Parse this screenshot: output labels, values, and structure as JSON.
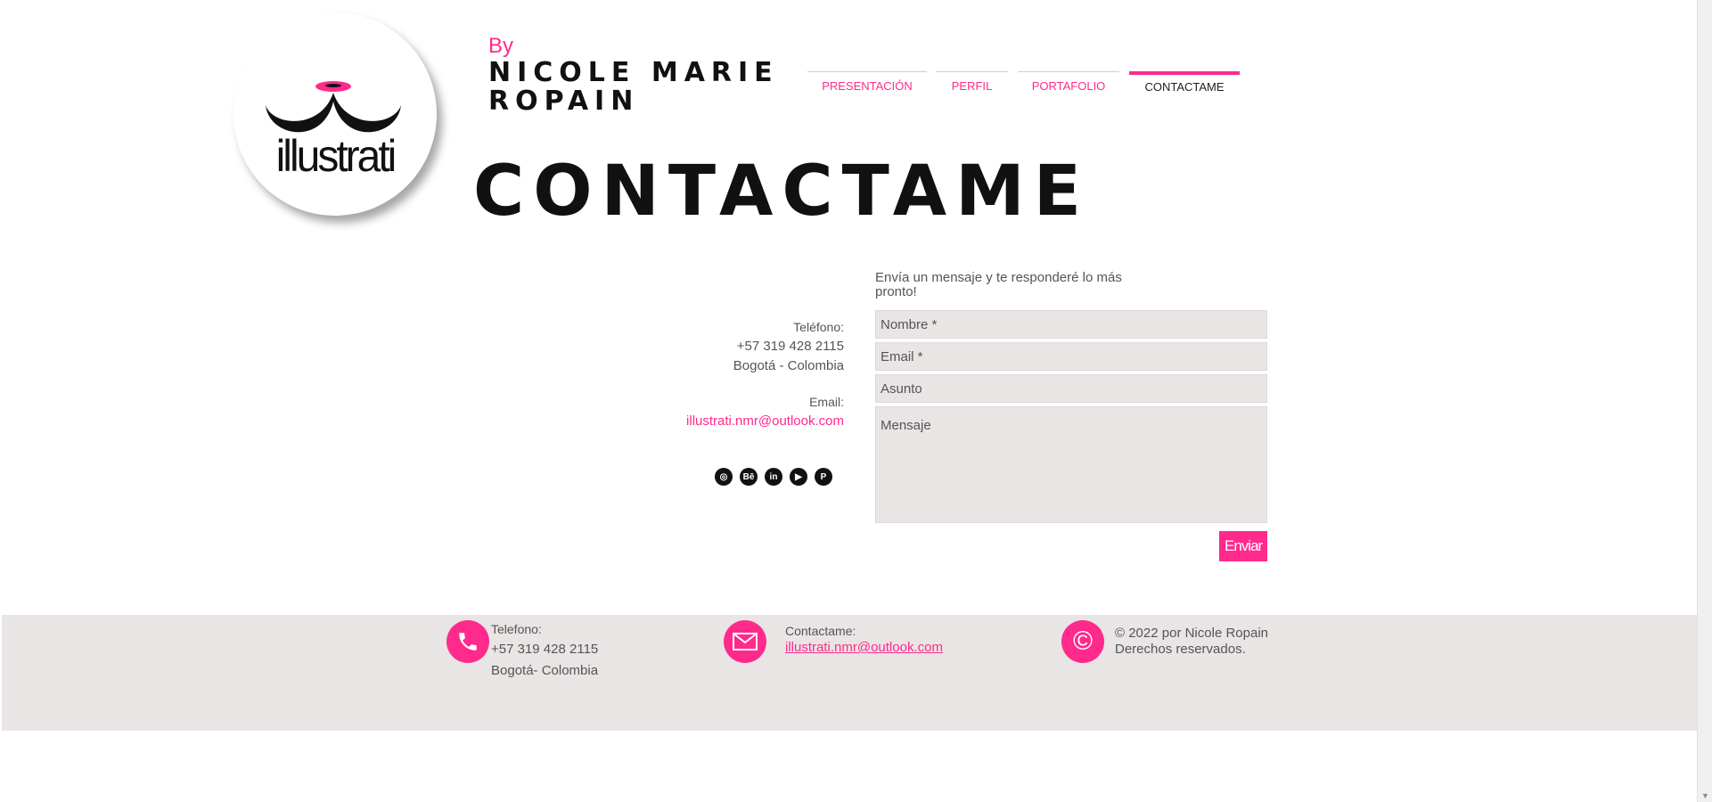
{
  "brand": {
    "logo_text": "illustrati",
    "by_label": "By",
    "name_line1": "NICOLE MARIE",
    "name_line2": "ROPAIN"
  },
  "nav": {
    "items": [
      {
        "label": "PRESENTACIÓN"
      },
      {
        "label": "PERFIL"
      },
      {
        "label": "PORTAFOLIO"
      },
      {
        "label": "CONTACTAME"
      }
    ],
    "active": "CONTACTAME"
  },
  "page_title": "CONTACTAME",
  "contact_info": {
    "phone_label": "Teléfono:",
    "phone": "+57  319 428 2115",
    "city": "Bogotá - Colombia",
    "email_label": "Email:",
    "email": "illustrati.nmr@outlook.com"
  },
  "social": [
    {
      "icon": "dribbble-icon",
      "glyph": "◎"
    },
    {
      "icon": "behance-icon",
      "glyph": "Bē"
    },
    {
      "icon": "linkedin-icon",
      "glyph": "in"
    },
    {
      "icon": "youtube-icon",
      "glyph": "▶"
    },
    {
      "icon": "pinterest-icon",
      "glyph": "P"
    }
  ],
  "form": {
    "intro": "Envía un mensaje y te responderé lo más pronto!",
    "name_placeholder": "Nombre *",
    "email_placeholder": "Email *",
    "subject_placeholder": "Asunto",
    "message_placeholder": "Mensaje",
    "submit_label": "Enviar"
  },
  "footer": {
    "phone_label": "Telefono:",
    "phone": "+57 319 428 2115",
    "city": "Bogotá- Colombia",
    "contact_label": "Contactame:",
    "email": "illustrati.nmr@outlook.com",
    "copyright_line1": "© 2022 por Nicole Ropain",
    "copyright_line2": "Derechos reservados."
  },
  "colors": {
    "accent": "#ff2a8c",
    "footer_bg": "#e8e5e4",
    "field_bg": "#e8e5e4",
    "text_dark": "#111111"
  }
}
